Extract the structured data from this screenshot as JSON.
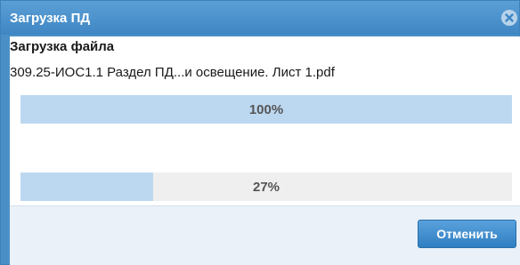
{
  "dialog": {
    "title": "Загрузка ПД",
    "close_icon": "close-circle-icon"
  },
  "content": {
    "heading": "Загрузка файла",
    "file_name": "309.25-ИОС1.1 Раздел ПД...и освещение. Лист 1.pdf"
  },
  "progress": [
    {
      "label": "100%",
      "fraction": 1.0
    },
    {
      "label": "27%",
      "fraction": 0.27
    }
  ],
  "footer": {
    "cancel_label": "Отменить"
  },
  "colors": {
    "titlebar": "#4a90c7",
    "progress_fill": "#bcd8f0",
    "progress_track": "#efefef",
    "button": "#3b8ad0"
  }
}
